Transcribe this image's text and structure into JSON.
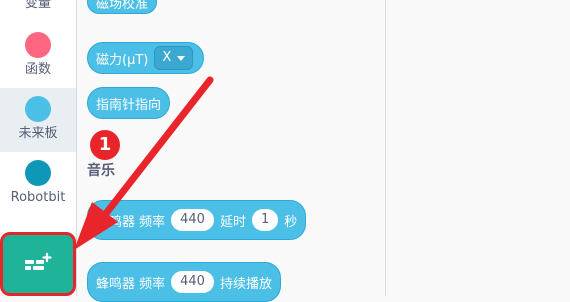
{
  "sidebar": {
    "items": [
      {
        "label": "变量",
        "color": "#ff8c1a"
      },
      {
        "label": "函数",
        "color": "#ff6680"
      },
      {
        "label": "未来板",
        "color": "#4cbfe6"
      },
      {
        "label": "Robotbit",
        "color": "#0f97b8"
      }
    ],
    "selected_index": 2,
    "extension_icon": "add-extension-icon"
  },
  "flyout": {
    "top_block_partial": "磁场校准",
    "magnetic_block": {
      "label": "磁力(μT)",
      "axis": "X"
    },
    "compass_block": {
      "label": "指南针指向"
    },
    "section_title": "音乐",
    "buzzer_delay_block": {
      "prefix": "蜂鸣器 频率",
      "freq": "440",
      "middle": "延时",
      "delay": "1",
      "unit": "秒"
    },
    "buzzer_continuous_block": {
      "prefix": "蜂鸣器 频率",
      "freq": "440",
      "suffix": "持续播放"
    }
  },
  "annotation": {
    "step_number": "1",
    "color": "#e8252a"
  },
  "colors": {
    "block": "#4cbfe6",
    "extension_button": "#1fb39a"
  }
}
